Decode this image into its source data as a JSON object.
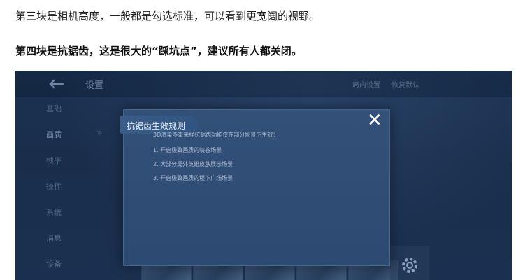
{
  "article": {
    "line1": "第三块是相机高度，一般都是勾选标准，可以看到更宽阔的视野。",
    "line2": "第四块是抗锯齿，这是很大的“踩坑点”，建议所有人都关闭。"
  },
  "game": {
    "header": {
      "title": "设置",
      "links": [
        "局内设置",
        "恢复默认"
      ]
    },
    "side_nav": {
      "items": [
        "基础",
        "画质",
        "帧率",
        "操作",
        "系统",
        "消息",
        "设备"
      ],
      "active": "画质"
    },
    "modal": {
      "title": "抗锯齿生效规则",
      "close_glyph": "✕",
      "intro": "3D渲染多重采样抗锯齿功能仅在部分场景下生效：",
      "rules": [
        "1. 开启极致画质的峡谷场景",
        "2. 大部分局外英雄皮肤展示场景",
        "3. 开启极致画质的稷下广场场景"
      ]
    }
  },
  "icons": {
    "back": "back-arrow-icon",
    "close": "close-icon",
    "gear": "gear-icon"
  },
  "colors": {
    "modal_bg": "#2f4c75",
    "game_bg": "#1c3252",
    "modal_text": "#aebed3",
    "title_text": "#e6eef8"
  }
}
